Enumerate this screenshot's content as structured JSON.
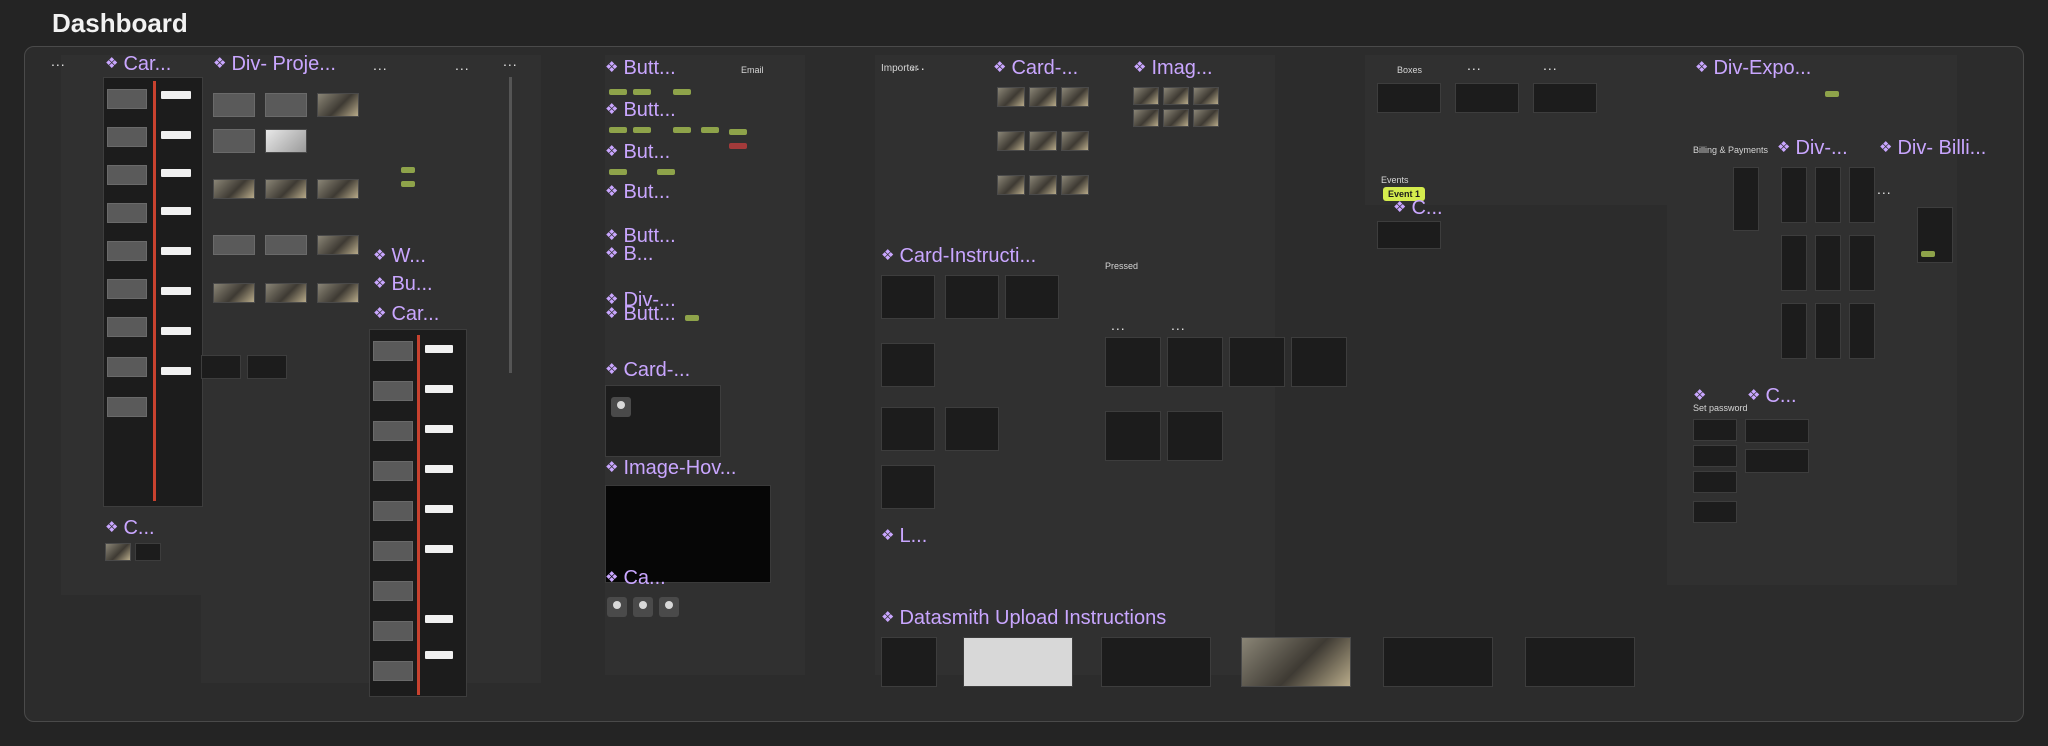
{
  "page": {
    "title": "Dashboard"
  },
  "labels": {
    "car1": "Car...",
    "div_proje": "Div- Proje...",
    "c_bottom": "C...",
    "w": "W...",
    "bu": "Bu...",
    "car2": "Car...",
    "butt1": "Butt...",
    "butt2": "Butt...",
    "but3": "But...",
    "but4": "But...",
    "butt5": "Butt...",
    "b": "B...",
    "div_mid": "Div-...",
    "butt6": "Butt...",
    "card_mid": "Card-...",
    "image_hov": "Image-Hov...",
    "ca": "Ca...",
    "card_top": "Card-...",
    "imag": "Imag...",
    "card_instructi": "Card-Instructi...",
    "l": "L...",
    "datasmith": "Datasmith Upload Instructions",
    "c_events": "C...",
    "div_expo": "Div-Expo...",
    "div_right": "Div-...",
    "div_billi": "Div- Billi...",
    "c_right": "C...",
    "e1": "...",
    "e2": "...",
    "e3": "...",
    "e4": "...",
    "e5": "...",
    "e6": "...",
    "e7": "...",
    "e8": "...",
    "e9": "...",
    "e10": "..."
  },
  "small_text": {
    "importer": "Importer",
    "events": "Events",
    "event_badge": "Event 1",
    "billing": "Billing & Payments",
    "boxes": "Boxes",
    "set_password": "Set password",
    "email": "Email",
    "pressed": "Pressed"
  },
  "icons": {
    "component": "component-icon",
    "avatar": "user-avatar-icon"
  },
  "colors": {
    "accent": "#c9a6ff",
    "highlight": "#d4ec4d",
    "green": "#8ea34a",
    "line": "#c8422f"
  }
}
